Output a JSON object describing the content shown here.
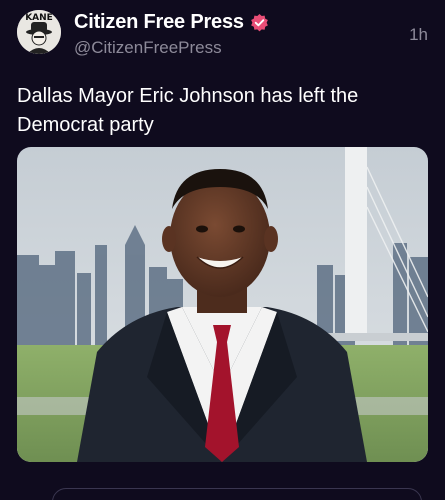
{
  "author": {
    "display_name": "Citizen Free Press",
    "handle": "@CitizenFreePress",
    "verified_icon": "verified-badge-icon",
    "avatar_icon": "kane-logo-avatar",
    "avatar_text": "KANE",
    "badge_color": "#e84d76"
  },
  "timestamp": "1h",
  "post": {
    "text": "Dallas Mayor Eric Johnson has left the Democrat party",
    "media_icon": "photo-man-in-suit-city-skyline"
  },
  "colors": {
    "background": "#0f0b1e",
    "secondary_text": "#8d8a99"
  }
}
